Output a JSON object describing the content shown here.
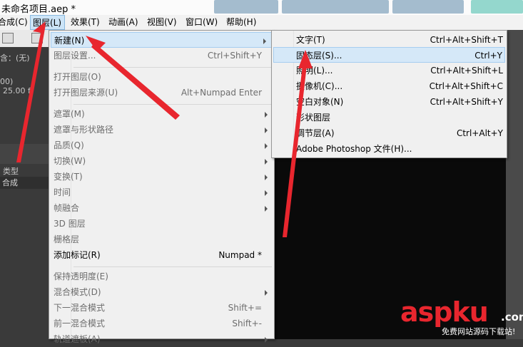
{
  "window": {
    "title": "未命名项目.aep *",
    "bg_tabs": [
      "",
      ""
    ]
  },
  "menubar": {
    "items": [
      {
        "label": "合成(C)"
      },
      {
        "label": "图层(L)"
      },
      {
        "label": "效果(T)"
      },
      {
        "label": "动画(A)"
      },
      {
        "label": "视图(V)"
      },
      {
        "label": "窗口(W)"
      },
      {
        "label": "帮助(H)"
      }
    ]
  },
  "left_panel": {
    "value_none": "含：(无)",
    "fps_prefix": "00)",
    "fps_value": "25.00 f",
    "column_label": "类型",
    "row_label": "合成"
  },
  "layer_menu": {
    "items": [
      {
        "label": "新建(N)",
        "shortcut": "",
        "submenu": true,
        "enabled": true
      },
      {
        "label": "图层设置...",
        "shortcut": "Ctrl+Shift+Y",
        "submenu": false,
        "enabled": false
      },
      {
        "label": "打开图层(O)",
        "shortcut": "",
        "submenu": false,
        "enabled": false
      },
      {
        "label": "打开图层来源(U)",
        "shortcut": "Alt+Numpad Enter",
        "submenu": false,
        "enabled": false
      },
      {
        "label": "遮罩(M)",
        "shortcut": "",
        "submenu": true,
        "enabled": false
      },
      {
        "label": "遮罩与形状路径",
        "shortcut": "",
        "submenu": true,
        "enabled": false
      },
      {
        "label": "品质(Q)",
        "shortcut": "",
        "submenu": true,
        "enabled": false
      },
      {
        "label": "切换(W)",
        "shortcut": "",
        "submenu": true,
        "enabled": false
      },
      {
        "label": "变换(T)",
        "shortcut": "",
        "submenu": true,
        "enabled": false
      },
      {
        "label": "时间",
        "shortcut": "",
        "submenu": true,
        "enabled": false
      },
      {
        "label": "帧融合",
        "shortcut": "",
        "submenu": true,
        "enabled": false
      },
      {
        "label": "3D 图层",
        "shortcut": "",
        "submenu": false,
        "enabled": false
      },
      {
        "label": "栅格层",
        "shortcut": "",
        "submenu": false,
        "enabled": false
      },
      {
        "label": "添加标记(R)",
        "shortcut": "Numpad *",
        "submenu": false,
        "enabled": true
      },
      {
        "label": "保持透明度(E)",
        "shortcut": "",
        "submenu": false,
        "enabled": false
      },
      {
        "label": "混合模式(D)",
        "shortcut": "",
        "submenu": true,
        "enabled": false
      },
      {
        "label": "下一混合模式",
        "shortcut": "Shift+=",
        "submenu": false,
        "enabled": false
      },
      {
        "label": "前一混合模式",
        "shortcut": "Shift+-",
        "submenu": false,
        "enabled": false
      },
      {
        "label": "轨道遮板(A)",
        "shortcut": "",
        "submenu": true,
        "enabled": false
      }
    ]
  },
  "new_submenu": {
    "items": [
      {
        "label": "文字(T)",
        "shortcut": "Ctrl+Alt+Shift+T"
      },
      {
        "label": "固态层(S)...",
        "shortcut": "Ctrl+Y"
      },
      {
        "label": "照明(L)...",
        "shortcut": "Ctrl+Alt+Shift+L"
      },
      {
        "label": "摄像机(C)...",
        "shortcut": "Ctrl+Alt+Shift+C"
      },
      {
        "label": "空白对象(N)",
        "shortcut": "Ctrl+Alt+Shift+Y"
      },
      {
        "label": "形状图层",
        "shortcut": ""
      },
      {
        "label": "调节层(A)",
        "shortcut": "Ctrl+Alt+Y"
      },
      {
        "label": "Adobe Photoshop 文件(H)...",
        "shortcut": ""
      }
    ]
  },
  "watermark": {
    "logo": "aspku",
    "dotcom": ".com",
    "subtitle": "免费网站源码下载站!"
  },
  "colors": {
    "arrow": "#e8262e",
    "highlight": "#d5e8f8"
  }
}
